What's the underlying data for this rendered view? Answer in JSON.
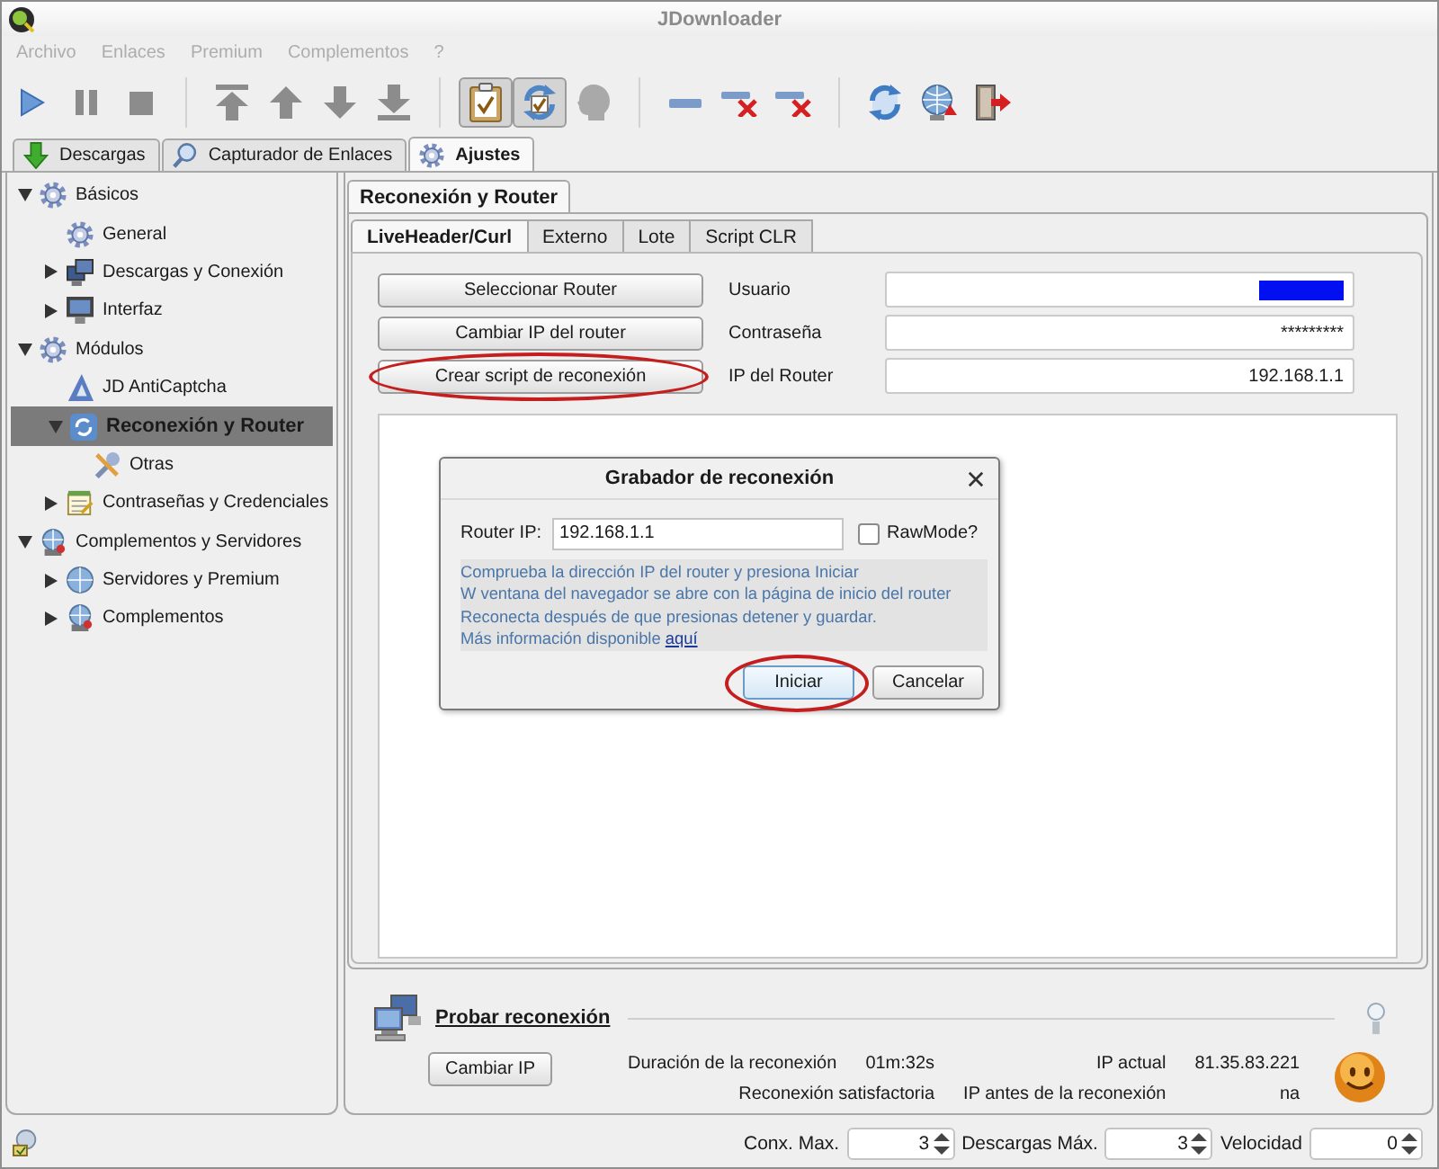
{
  "window": {
    "title": "JDownloader"
  },
  "menu": [
    {
      "label": "Archivo",
      "disabled": true
    },
    {
      "label": "Enlaces",
      "disabled": true
    },
    {
      "label": "Premium",
      "disabled": true
    },
    {
      "label": "Complementos",
      "disabled": true
    },
    {
      "label": "?",
      "disabled": true
    }
  ],
  "toolbar": [
    [
      {
        "kind": "start",
        "pressed": false
      },
      {
        "kind": "pause",
        "pressed": false
      },
      {
        "kind": "stop",
        "pressed": false
      }
    ],
    [
      {
        "kind": "move-top",
        "pressed": false
      },
      {
        "kind": "move-up",
        "pressed": false
      },
      {
        "kind": "move-down",
        "pressed": false
      },
      {
        "kind": "move-bottom",
        "pressed": false
      }
    ],
    [
      {
        "kind": "clipboard-watch",
        "pressed": true
      },
      {
        "kind": "auto-reconnect",
        "pressed": true
      },
      {
        "kind": "premium",
        "pressed": false
      }
    ],
    [
      {
        "kind": "remove",
        "pressed": false
      },
      {
        "kind": "remove-finished",
        "pressed": false
      },
      {
        "kind": "remove-failed",
        "pressed": false
      }
    ],
    [
      {
        "kind": "reconnect",
        "pressed": false
      },
      {
        "kind": "update",
        "pressed": false
      },
      {
        "kind": "exit",
        "pressed": false
      }
    ]
  ],
  "main_tabs": [
    {
      "label": "Descargas",
      "kind": "downloads",
      "selected": false
    },
    {
      "label": "Capturador de Enlaces",
      "kind": "linkgrabber",
      "selected": false
    },
    {
      "label": "Ajustes",
      "kind": "settings",
      "selected": true
    }
  ],
  "sidebar": {
    "items": [
      {
        "label": "Básicos",
        "kind": "group",
        "expanded": true,
        "selected": false,
        "children": [
          {
            "label": "General",
            "kind": "general",
            "selected": false
          },
          {
            "label": "Descargas y Conexión",
            "kind": "downloads",
            "expanded": false,
            "selected": false
          },
          {
            "label": "Interfaz",
            "kind": "interface",
            "expanded": false,
            "selected": false
          }
        ]
      },
      {
        "label": "Módulos",
        "kind": "group",
        "expanded": true,
        "selected": false,
        "children": [
          {
            "label": "JD AntiCaptcha",
            "kind": "captcha",
            "selected": false
          },
          {
            "label": "Reconexión y Router",
            "kind": "reconnect",
            "expanded": true,
            "selected": true,
            "children": [
              {
                "label": "Otras",
                "kind": "tools",
                "selected": false
              }
            ]
          },
          {
            "label": "Contraseñas y Credenciales",
            "kind": "passwords",
            "expanded": false,
            "selected": false
          }
        ]
      },
      {
        "label": "Complementos y Servidores",
        "kind": "plugins",
        "expanded": true,
        "selected": false,
        "children": [
          {
            "label": "Servidores y Premium",
            "kind": "premium",
            "expanded": false,
            "selected": false
          },
          {
            "label": "Complementos",
            "kind": "addons",
            "expanded": false,
            "selected": false
          }
        ]
      }
    ]
  },
  "settings": {
    "tabs": [
      {
        "label": "Reconexión y Router",
        "selected": true
      }
    ],
    "subtabs": [
      {
        "label": "LiveHeader/Curl",
        "selected": true
      },
      {
        "label": "Externo",
        "selected": false
      },
      {
        "label": "Lote",
        "selected": false
      },
      {
        "label": "Script CLR",
        "selected": false
      }
    ],
    "buttons": [
      {
        "label": "Seleccionar Router",
        "highlighted": false
      },
      {
        "label": "Cambiar IP del router",
        "highlighted": false
      },
      {
        "label": "Crear script de reconexión",
        "highlighted": true
      }
    ],
    "fields": [
      {
        "label": "Usuario",
        "redacted": true
      },
      {
        "label": "Contraseña",
        "value": "*********",
        "redacted": false
      },
      {
        "label": "IP del Router",
        "value": "192.168.1.1",
        "redacted": false
      }
    ]
  },
  "dialog": {
    "title": "Grabador de reconexión",
    "ip_label": "Router IP:",
    "ip_value": "192.168.1.1",
    "rawmode": {
      "label": "RawMode?",
      "checked": false
    },
    "info": {
      "lines": [
        "Comprueba la dirección IP del router y presiona Iniciar",
        "W ventana del navegador se abre con la página de inicio del router",
        "Reconecta después de que presionas detener y guardar."
      ],
      "last_line": "Más información disponible",
      "link": "aquí"
    },
    "buttons": [
      {
        "label": "Iniciar",
        "focused": true,
        "highlighted": true
      },
      {
        "label": "Cancelar",
        "focused": false,
        "highlighted": false
      }
    ]
  },
  "reconnect_test": {
    "title": "Probar reconexión",
    "button": "Cambiar IP",
    "duration": {
      "label": "Duración de la reconexión",
      "value": "01m:32s"
    },
    "status": "Reconexión satisfactoria",
    "current_ip": {
      "label": "IP actual",
      "value": "81.35.83.221"
    },
    "previous_ip": {
      "label": "IP antes de la reconexión",
      "value": "na"
    },
    "success": true
  },
  "status_bar": {
    "spinners": [
      {
        "label": "Conx. Max.",
        "value": "3"
      },
      {
        "label": "Descargas Máx.",
        "value": "3"
      },
      {
        "label": "Velocidad",
        "value": "0"
      }
    ]
  }
}
